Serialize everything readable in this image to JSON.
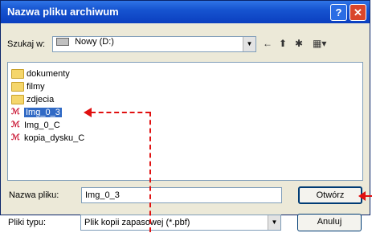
{
  "window": {
    "title": "Nazwa pliku archiwum",
    "help_label": "?",
    "close_label": "✕"
  },
  "lookin": {
    "label": "Szukaj w:",
    "value": "Nowy (D:)"
  },
  "toolbar": {
    "back": "←",
    "up": "⬆",
    "newfolder": "✱",
    "view": "▦▾"
  },
  "files": [
    {
      "name": "dokumenty",
      "type": "folder"
    },
    {
      "name": "filmy",
      "type": "folder"
    },
    {
      "name": "zdjecia",
      "type": "folder"
    },
    {
      "name": "Img_0_3",
      "type": "pbf",
      "selected": true
    },
    {
      "name": "Img_0_C",
      "type": "pbf"
    },
    {
      "name": "kopia_dysku_C",
      "type": "pbf"
    }
  ],
  "filename": {
    "label": "Nazwa pliku:",
    "value": "Img_0_3"
  },
  "filetype": {
    "label": "Pliki typu:",
    "value": "Plik kopii zapasowej (*.pbf)"
  },
  "buttons": {
    "open": "Otwórz",
    "cancel": "Anuluj"
  },
  "colors": {
    "selection": "#316ac5",
    "annotation": "#e01010"
  }
}
